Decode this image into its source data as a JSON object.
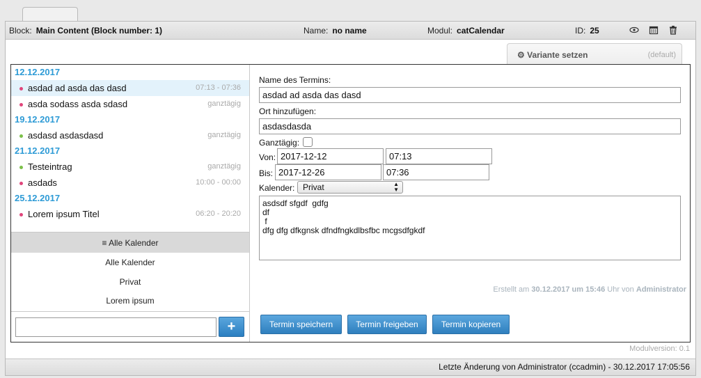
{
  "header": {
    "block_label": "Block:",
    "block_value": "Main Content (Block number: 1)",
    "name_label": "Name:",
    "name_value": "no name",
    "modul_label": "Modul:",
    "modul_value": "catCalendar",
    "id_label": "ID:",
    "id_value": "25",
    "icons": [
      "eye-icon",
      "calendar-icon",
      "trash-icon"
    ]
  },
  "variant": {
    "label": "Variante setzen",
    "default": "(default)",
    "icon": "gear-icon"
  },
  "events": [
    {
      "date": "12.12.2017",
      "items": [
        {
          "title": "asdad ad asda das dasd",
          "time": "07:13 - 07:36",
          "color": "#e0457b",
          "selected": true
        },
        {
          "title": "asda sodass asda sdasd",
          "time": "ganztägig",
          "color": "#e0457b"
        }
      ]
    },
    {
      "date": "19.12.2017",
      "items": [
        {
          "title": "asdasd asdasdasd",
          "time": "ganztägig",
          "color": "#7cc04a"
        }
      ]
    },
    {
      "date": "21.12.2017",
      "items": [
        {
          "title": "Testeintrag",
          "time": "ganztägig",
          "color": "#7cc04a"
        },
        {
          "title": "asdads",
          "time": "10:00 - 00:00",
          "color": "#e0457b"
        }
      ]
    },
    {
      "date": "25.12.2017",
      "items": [
        {
          "title": "Lorem ipsum Titel",
          "time": "06:20 - 20:20",
          "color": "#e0457b"
        }
      ]
    }
  ],
  "calendars": {
    "header": "Alle Kalender",
    "items": [
      "Alle Kalender",
      "Privat",
      "Lorem ipsum"
    ]
  },
  "new_entry": {
    "value": "",
    "plus_label": "+"
  },
  "form": {
    "name_label": "Name des Termins:",
    "name_value": "asdad ad asda das dasd",
    "ort_label": "Ort hinzufügen:",
    "ort_value": "asdasdasda",
    "ganztaegig_label": "Ganztägig:",
    "ganztaegig_checked": false,
    "von_label": "Von:",
    "von_date": "2017-12-12",
    "von_time": "07:13",
    "bis_label": "Bis:",
    "bis_date": "2017-12-26",
    "bis_time": "07:36",
    "kalender_label": "Kalender:",
    "kalender_value": "Privat",
    "description": "asdsdf sfgdf  gdfg\ndf\n f\ndfg dfg dfkgnsk dfndfngkdlbsfbc mcgsdfgkdf",
    "created_prefix": "Erstellt am",
    "created_date": "30.12.2017 um 15:46",
    "created_mid": "Uhr von",
    "created_user": "Administrator"
  },
  "buttons": {
    "save": "Termin speichern",
    "release": "Termin freigeben",
    "copy": "Termin kopieren"
  },
  "modulversion": "Modulversion: 0.1",
  "footer": "Letzte Änderung von Administrator (ccadmin) - 30.12.2017 17:05:56"
}
